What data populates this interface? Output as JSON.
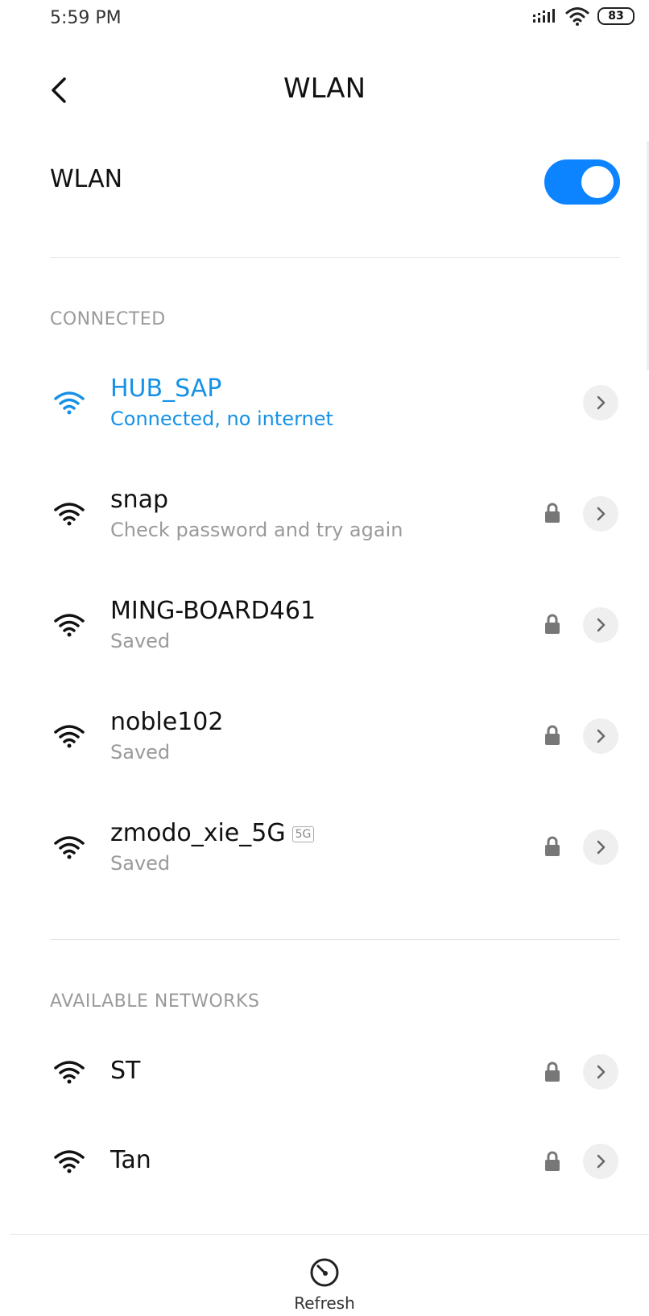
{
  "status_bar": {
    "time": "5:59 PM",
    "battery": "83"
  },
  "header": {
    "title": "WLAN"
  },
  "master_toggle": {
    "label": "WLAN",
    "enabled": true
  },
  "sections": {
    "connected_label": "CONNECTED",
    "available_label": "AVAILABLE NETWORKS"
  },
  "connected_network": {
    "name": "HUB_SAP",
    "status": "Connected, no internet"
  },
  "saved_networks": [
    {
      "name": "snap",
      "status": "Check password and try again",
      "badge": ""
    },
    {
      "name": "MING-BOARD461",
      "status": "Saved",
      "badge": ""
    },
    {
      "name": "noble102",
      "status": "Saved",
      "badge": ""
    },
    {
      "name": "zmodo_xie_5G",
      "status": "Saved",
      "badge": "5G"
    }
  ],
  "available_networks": [
    {
      "name": "ST"
    },
    {
      "name": "Tan"
    }
  ],
  "bottom_bar": {
    "refresh_label": "Refresh"
  },
  "colors": {
    "accent": "#0d84ff",
    "connected_text": "#1691e6",
    "secondary_text": "#9a9a9a"
  },
  "icons": {
    "back": "chevron-left-icon",
    "wifi": "wifi-icon",
    "lock": "lock-icon",
    "detail": "chevron-right-icon",
    "refresh": "refresh-icon"
  }
}
